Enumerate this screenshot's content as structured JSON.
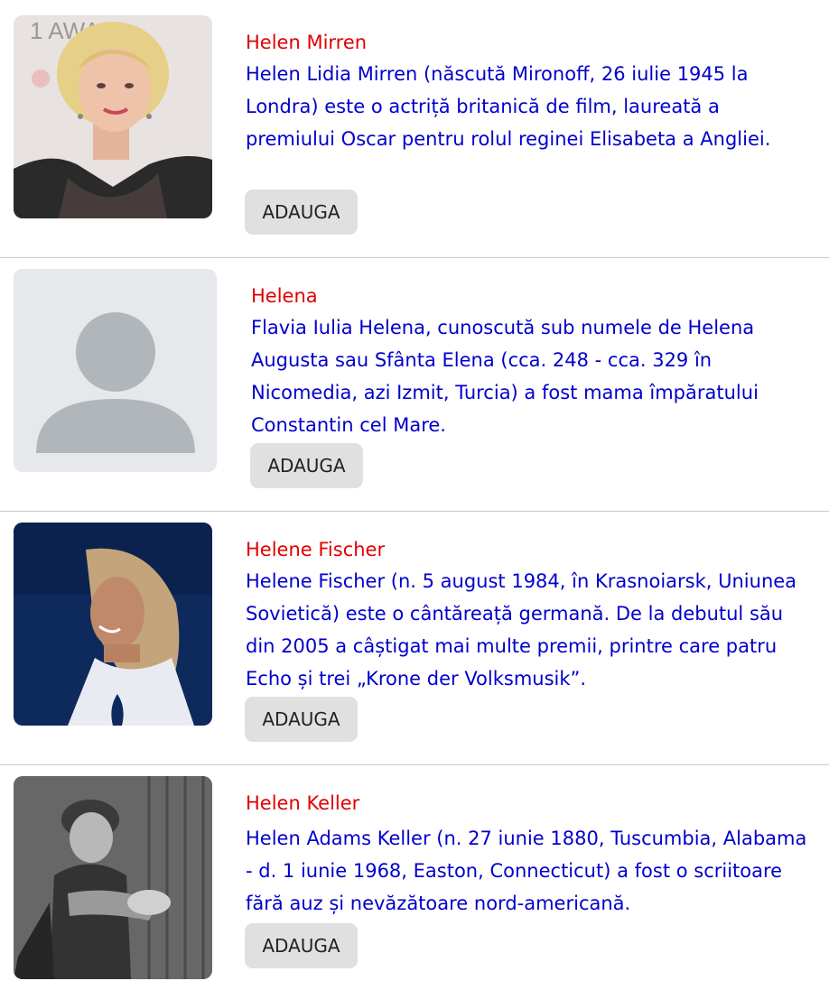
{
  "results": [
    {
      "name": "Helen Mirren",
      "description": "Helen Lidia Mirren (născută Mironoff, 26 iulie 1945 la Londra) este o actriță britanică de film, laureată a premiului Oscar pentru rolul reginei Elisabeta a Angliei.",
      "button_label": "ADAUGA",
      "photo": "portrait-photo"
    },
    {
      "name": "Helena",
      "description": "Flavia Iulia Helena, cunoscută sub numele de Helena Augusta sau Sfânta Elena (cca. 248 - cca. 329 în Nicomedia, azi Izmit, Turcia) a fost mama împăratului Constantin cel Mare.",
      "button_label": "ADAUGA",
      "photo": "default-avatar-placeholder"
    },
    {
      "name": "Helene Fischer",
      "description": "Helene Fischer (n. 5 august 1984, în Krasnoiarsk, Uniunea Sovietică) este o cântăreață germană. De la debutul său din 2005 a câștigat mai multe premii, printre care patru Echo și trei „Krone der Volksmusik”.",
      "button_label": "ADAUGA",
      "photo": "portrait-photo"
    },
    {
      "name": "Helen Keller",
      "description": "Helen Adams Keller (n. 27 iunie 1880, Tuscumbia, Alabama - d. 1 iunie 1968, Easton, Connecticut) a fost o scriitoare fără auz și nevăzătoare nord-americană.",
      "button_label": "ADAUGA",
      "photo": "portrait-photo"
    }
  ],
  "colors": {
    "name": "#e00000",
    "description": "#0000cc",
    "button_bg": "#e0e0e0",
    "separator": "#c9c9c9"
  }
}
